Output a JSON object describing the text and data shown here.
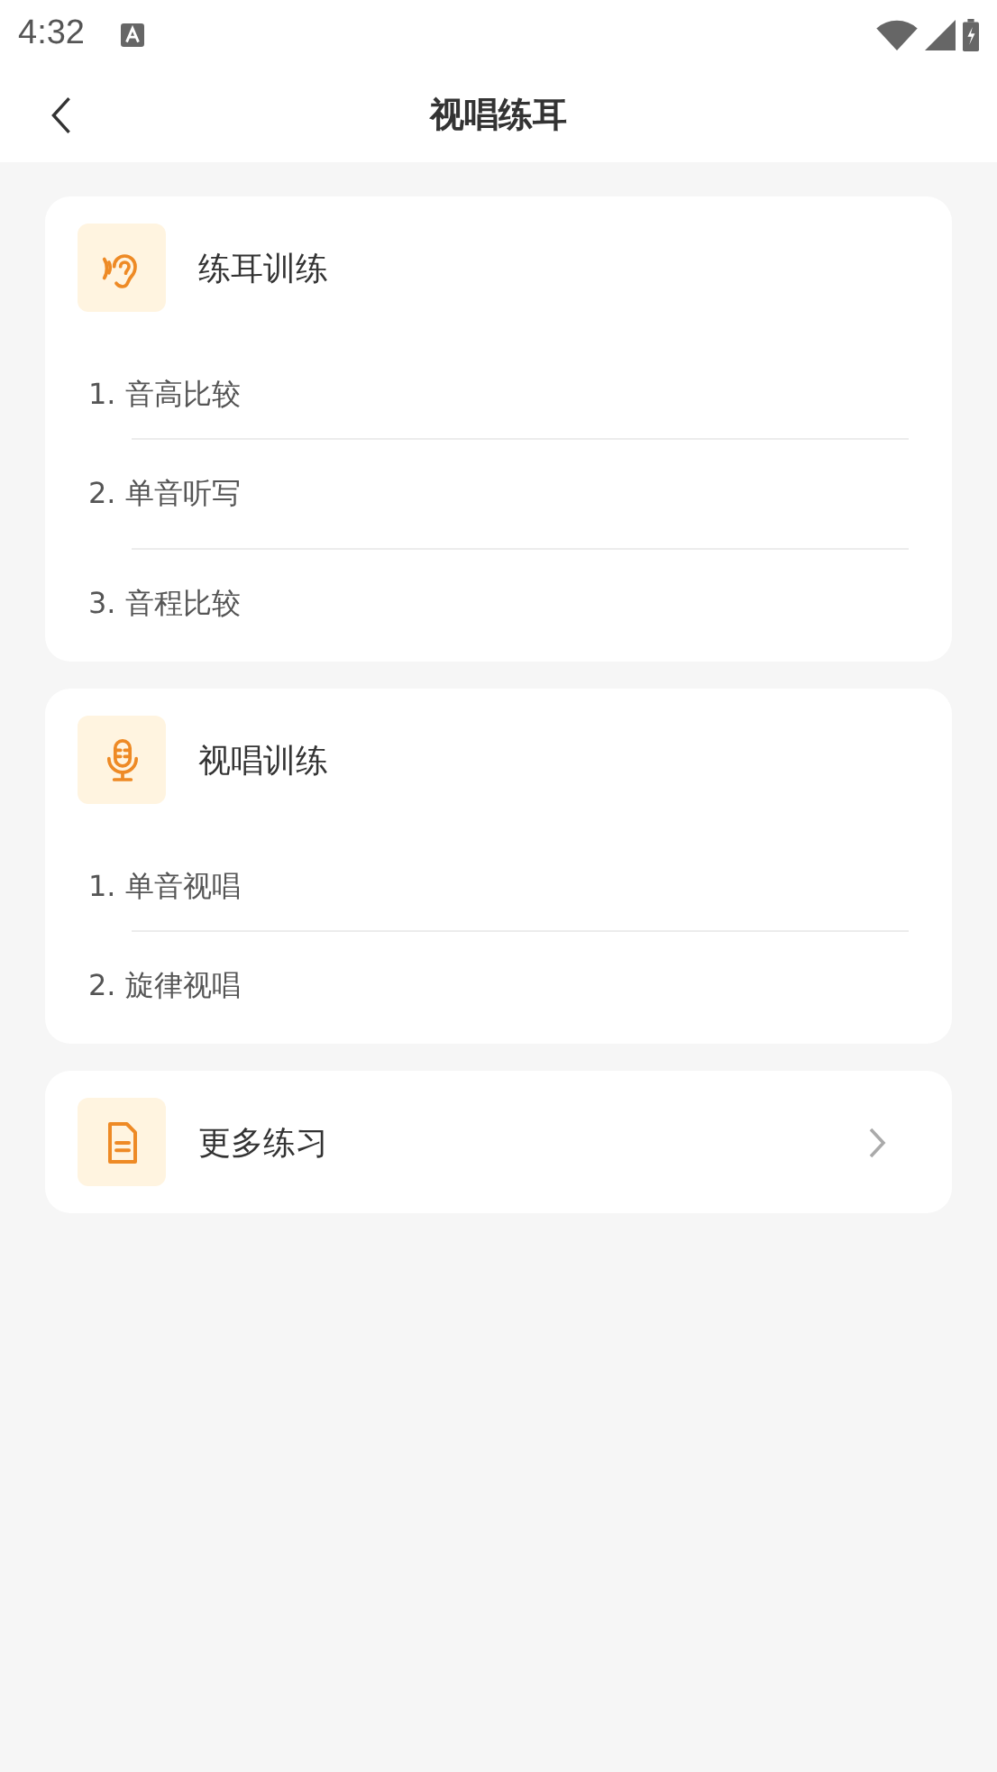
{
  "status_bar": {
    "time": "4:32"
  },
  "nav": {
    "title": "视唱练耳"
  },
  "cards": [
    {
      "kind": "section",
      "title": "练耳训练",
      "items": [
        "1. 音高比较",
        "2. 单音听写",
        "3. 音程比较"
      ]
    },
    {
      "kind": "section",
      "title": "视唱训练",
      "items": [
        "1. 单音视唱",
        "2. 旋律视唱"
      ]
    },
    {
      "kind": "link",
      "title": "更多练习"
    }
  ]
}
